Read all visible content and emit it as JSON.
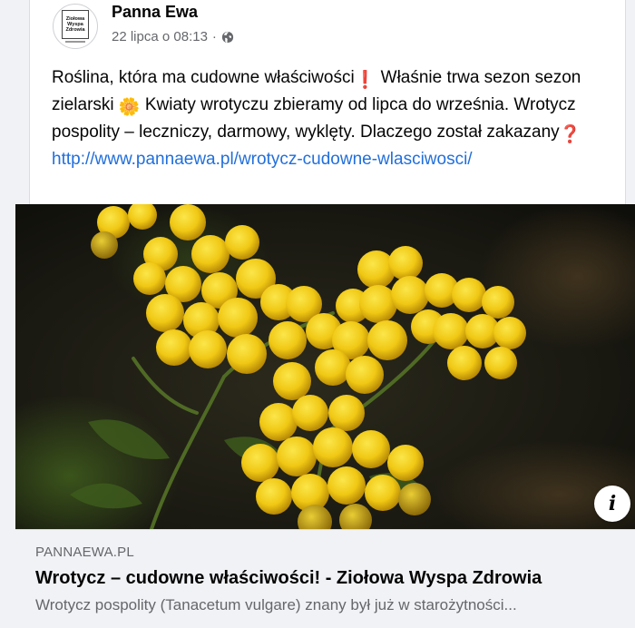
{
  "post": {
    "author": "Panna Ewa",
    "timestamp": "22 lipca o 08:13",
    "separator": "·",
    "privacy_icon": "globe-icon",
    "avatar_lines": [
      "Ziołowa",
      "Wyspa",
      "Zdrowia"
    ],
    "text": {
      "part1": "Roślina, która ma cudowne właściwości",
      "emoji1": "❗",
      "part2": " Właśnie trwa sezon sezon zielarski ",
      "emoji2": "🌼",
      "part3": " Kwiaty wrotyczu zbieramy od lipca do września. Wrotycz pospolity – leczniczy, darmowy, wyklęty. Dlaczego został zakazany",
      "emoji3": "❓",
      "link": "http://www.pannaewa.pl/wrotycz-cudowne-wlasciwosci/"
    }
  },
  "link_preview": {
    "domain": "PANNAEWA.PL",
    "title": "Wrotycz – cudowne właściwości! - Ziołowa Wyspa Zdrowia",
    "description": "Wrotycz pospolity (Tanacetum vulgare) znany był już w starożytności...",
    "info_icon": "i"
  },
  "colors": {
    "link": "#216fdb",
    "flower": "#f2cf1a",
    "background_dark": "#1c1a14"
  }
}
